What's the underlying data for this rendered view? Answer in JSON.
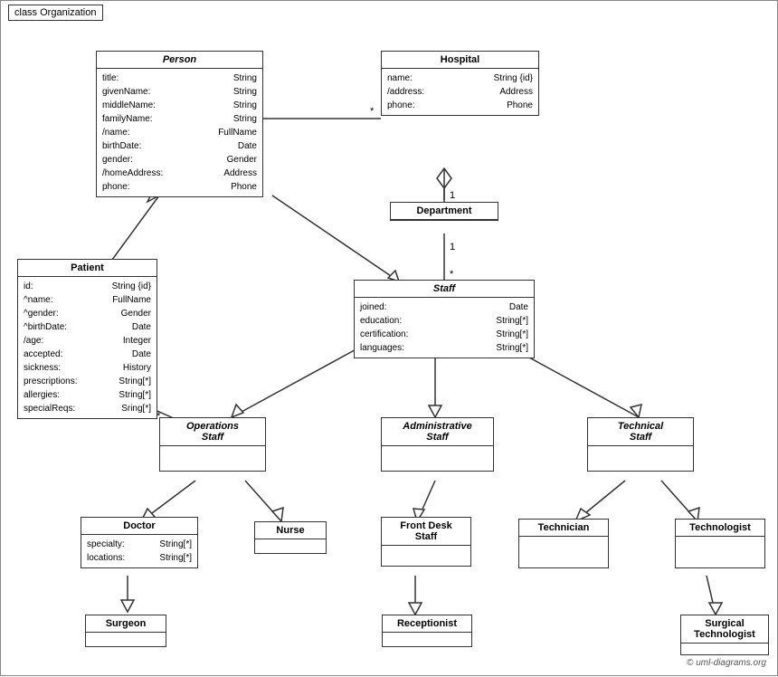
{
  "diagram": {
    "title": "class Organization",
    "classes": {
      "person": {
        "name": "Person",
        "italic": true,
        "attributes": [
          {
            "name": "title:",
            "type": "String"
          },
          {
            "name": "givenName:",
            "type": "String"
          },
          {
            "name": "middleName:",
            "type": "String"
          },
          {
            "name": "familyName:",
            "type": "String"
          },
          {
            "name": "/name:",
            "type": "FullName"
          },
          {
            "name": "birthDate:",
            "type": "Date"
          },
          {
            "name": "gender:",
            "type": "Gender"
          },
          {
            "name": "/homeAddress:",
            "type": "Address"
          },
          {
            "name": "phone:",
            "type": "Phone"
          }
        ]
      },
      "hospital": {
        "name": "Hospital",
        "italic": false,
        "attributes": [
          {
            "name": "name:",
            "type": "String {id}"
          },
          {
            "name": "/address:",
            "type": "Address"
          },
          {
            "name": "phone:",
            "type": "Phone"
          }
        ]
      },
      "department": {
        "name": "Department",
        "italic": false,
        "attributes": []
      },
      "staff": {
        "name": "Staff",
        "italic": true,
        "attributes": [
          {
            "name": "joined:",
            "type": "Date"
          },
          {
            "name": "education:",
            "type": "String[*]"
          },
          {
            "name": "certification:",
            "type": "String[*]"
          },
          {
            "name": "languages:",
            "type": "String[*]"
          }
        ]
      },
      "patient": {
        "name": "Patient",
        "italic": false,
        "attributes": [
          {
            "name": "id:",
            "type": "String {id}"
          },
          {
            "name": "^name:",
            "type": "FullName"
          },
          {
            "name": "^gender:",
            "type": "Gender"
          },
          {
            "name": "^birthDate:",
            "type": "Date"
          },
          {
            "name": "/age:",
            "type": "Integer"
          },
          {
            "name": "accepted:",
            "type": "Date"
          },
          {
            "name": "sickness:",
            "type": "History"
          },
          {
            "name": "prescriptions:",
            "type": "String[*]"
          },
          {
            "name": "allergies:",
            "type": "String[*]"
          },
          {
            "name": "specialReqs:",
            "type": "Sring[*]"
          }
        ]
      },
      "operations_staff": {
        "name": "Operations Staff",
        "italic": true,
        "attributes": []
      },
      "administrative_staff": {
        "name": "Administrative Staff",
        "italic": true,
        "attributes": []
      },
      "technical_staff": {
        "name": "Technical Staff",
        "italic": true,
        "attributes": []
      },
      "doctor": {
        "name": "Doctor",
        "italic": false,
        "attributes": [
          {
            "name": "specialty:",
            "type": "String[*]"
          },
          {
            "name": "locations:",
            "type": "String[*]"
          }
        ]
      },
      "nurse": {
        "name": "Nurse",
        "italic": false,
        "attributes": []
      },
      "front_desk_staff": {
        "name": "Front Desk Staff",
        "italic": false,
        "attributes": []
      },
      "technician": {
        "name": "Technician",
        "italic": false,
        "attributes": []
      },
      "technologist": {
        "name": "Technologist",
        "italic": false,
        "attributes": []
      },
      "surgeon": {
        "name": "Surgeon",
        "italic": false,
        "attributes": []
      },
      "receptionist": {
        "name": "Receptionist",
        "italic": false,
        "attributes": []
      },
      "surgical_technologist": {
        "name": "Surgical Technologist",
        "italic": false,
        "attributes": []
      }
    },
    "copyright": "© uml-diagrams.org"
  }
}
